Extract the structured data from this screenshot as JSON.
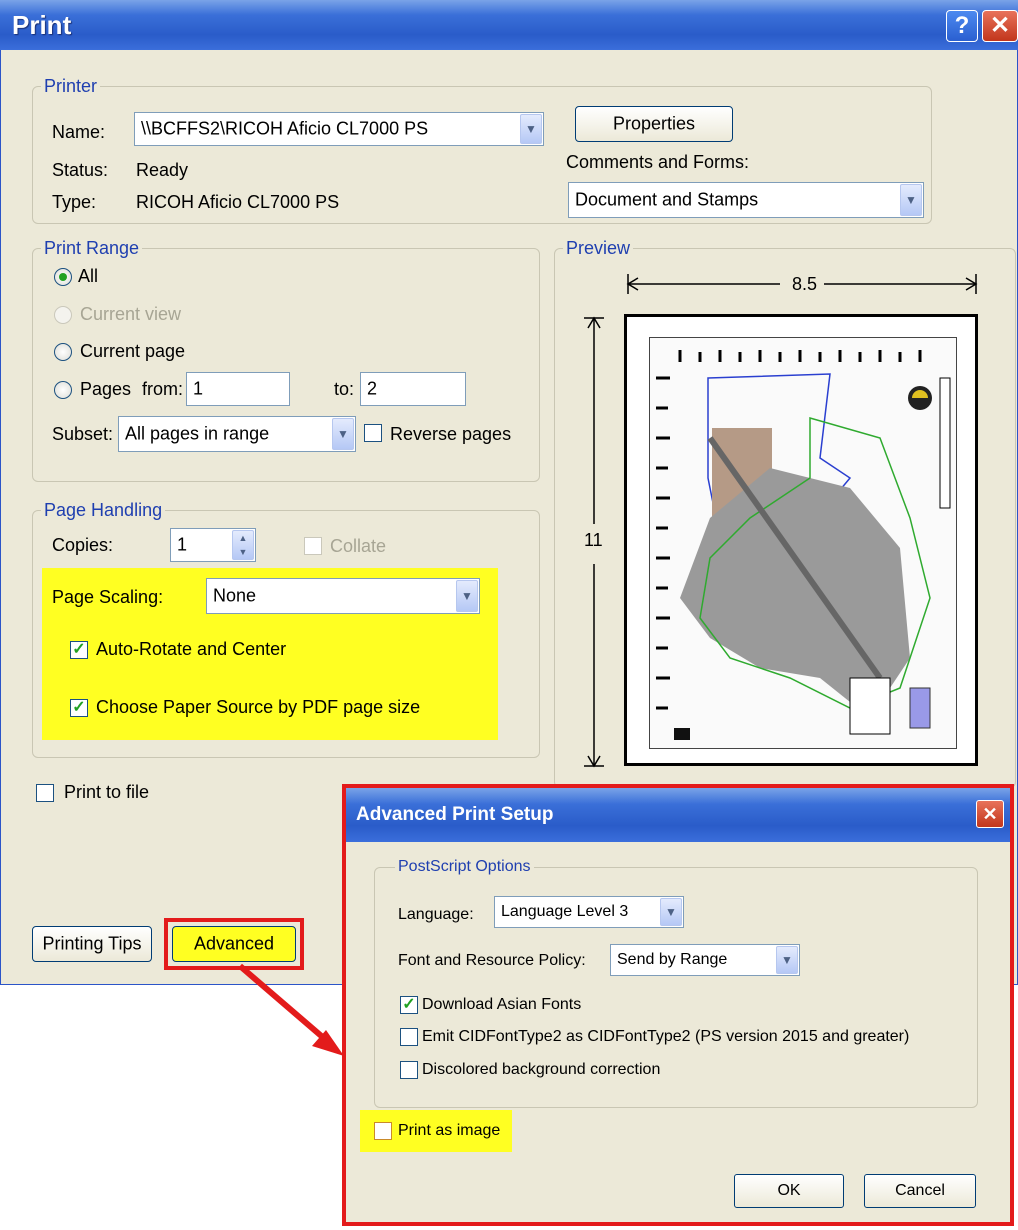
{
  "print_dialog": {
    "title": "Print",
    "help_glyph": "?",
    "close_glyph": "✕",
    "printer": {
      "legend": "Printer",
      "name_label": "Name:",
      "name_value": "\\\\BCFFS2\\RICOH Aficio CL7000 PS",
      "status_label": "Status:",
      "status_value": "Ready",
      "type_label": "Type:",
      "type_value": "RICOH Aficio CL7000 PS",
      "properties_label": "Properties",
      "comments_label": "Comments and Forms:",
      "comments_value": "Document and Stamps"
    },
    "print_range": {
      "legend": "Print Range",
      "all_label": "All",
      "current_view_label": "Current view",
      "current_page_label": "Current page",
      "pages_label": "Pages",
      "from_label": "from:",
      "from_value": "1",
      "to_label": "to:",
      "to_value": "2",
      "subset_label": "Subset:",
      "subset_value": "All pages in range",
      "reverse_label": "Reverse pages",
      "selected": "All"
    },
    "page_handling": {
      "legend": "Page Handling",
      "copies_label": "Copies:",
      "copies_value": "1",
      "collate_label": "Collate",
      "scaling_label": "Page Scaling:",
      "scaling_value": "None",
      "auto_rotate_label": "Auto-Rotate and Center",
      "auto_rotate_checked": true,
      "paper_source_label": "Choose Paper Source by PDF page size",
      "paper_source_checked": true
    },
    "preview": {
      "legend": "Preview",
      "width_label": "8.5",
      "height_label": "11"
    },
    "print_to_file_label": "Print to file",
    "printing_tips_label": "Printing Tips",
    "advanced_label": "Advanced"
  },
  "advanced_dialog": {
    "title": "Advanced Print Setup",
    "close_glyph": "✕",
    "postscript": {
      "legend": "PostScript Options",
      "language_label": "Language:",
      "language_value": "Language Level 3",
      "font_policy_label": "Font and Resource Policy:",
      "font_policy_value": "Send by Range",
      "download_asian_label": "Download Asian Fonts",
      "download_asian_checked": true,
      "emit_cid_label": "Emit CIDFontType2 as CIDFontType2 (PS version 2015 and greater)",
      "discolored_label": "Discolored background correction"
    },
    "print_as_image_label": "Print as image",
    "ok_label": "OK",
    "cancel_label": "Cancel"
  },
  "colors": {
    "highlight": "#ffff22",
    "callout_red": "#e31b1b",
    "title_blue": "#2a5cc9",
    "window_bg": "#ece9d8"
  }
}
